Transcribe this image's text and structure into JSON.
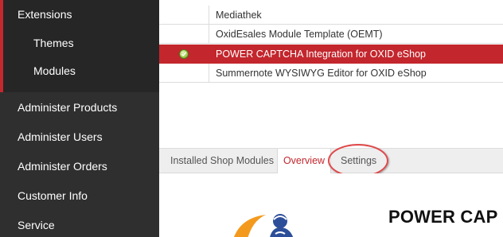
{
  "sidebar": {
    "extensions_label": "Extensions",
    "themes_label": "Themes",
    "modules_label": "Modules",
    "items": [
      {
        "label": "Administer Products"
      },
      {
        "label": "Administer Users"
      },
      {
        "label": "Administer Orders"
      },
      {
        "label": "Customer Info"
      },
      {
        "label": "Service"
      }
    ],
    "accent_color": "#c3282e"
  },
  "module_list": {
    "rows": [
      {
        "name": "Mediathek",
        "active": false
      },
      {
        "name": "OxidEsales Module Template (OEMT)",
        "active": false
      },
      {
        "name": "POWER CAPTCHA Integration for OXID eShop",
        "active": true,
        "status_icon": "check-circle-icon"
      },
      {
        "name": "Summernote WYSIWYG Editor for OXID eShop",
        "active": false
      }
    ],
    "selected_color": "#c3262d"
  },
  "tabs": {
    "installed_label": "Installed Shop Modules",
    "overview_label": "Overview",
    "settings_label": "Settings"
  },
  "module_detail": {
    "title": "POWER CAP",
    "logo_icon": "power-captcha-logo"
  }
}
